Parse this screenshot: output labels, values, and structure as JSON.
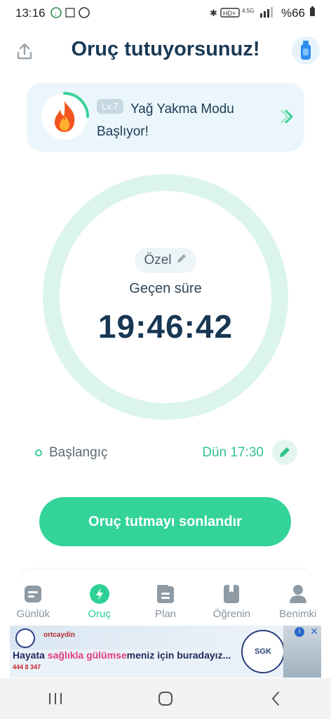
{
  "status_bar": {
    "time": "13:16",
    "battery": "%66"
  },
  "header": {
    "title": "Oruç tutuyorsunuz!"
  },
  "level_card": {
    "level": "Lv.7",
    "text": "Yağ Yakma Modu Başlıyor!"
  },
  "timer": {
    "mode": "Özel",
    "label": "Geçen süre",
    "value": "19:46:42"
  },
  "start": {
    "label": "Başlangıç",
    "time": "Dün 17:30"
  },
  "end_button": "Oruç tutmayı sonlandır",
  "tabs": [
    {
      "label": "Günlük"
    },
    {
      "label": "Oruç"
    },
    {
      "label": "Plan"
    },
    {
      "label": "Öğrenin"
    },
    {
      "label": "Benimki"
    }
  ],
  "ad": {
    "brand": "ortcaydin",
    "slogan_a": "Hayata ",
    "slogan_b": "sağlıkla gülümse",
    "slogan_c": "meniz için buradayız...",
    "phone": "444 8 347",
    "seal": "SGK"
  },
  "colors": {
    "accent": "#33d39a",
    "title": "#1a3a56",
    "ring": "#dcf5ea"
  }
}
